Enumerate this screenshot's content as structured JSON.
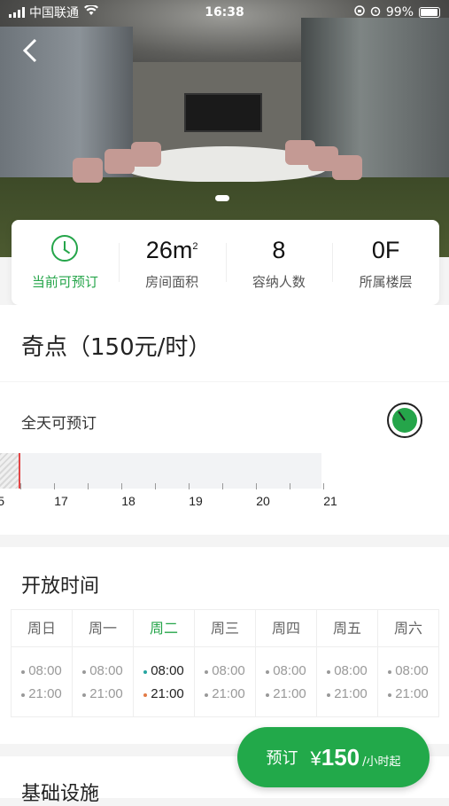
{
  "status_bar": {
    "carrier": "中国联通",
    "time": "16:38",
    "battery": "99%"
  },
  "stats": [
    {
      "value": "",
      "label": "当前可预订"
    },
    {
      "value": "26m",
      "sup": "2",
      "label": "房间面积"
    },
    {
      "value": "8",
      "label": "容纳人数"
    },
    {
      "value": "0F",
      "label": "所属楼层"
    }
  ],
  "room": {
    "title": "奇点（150元/时）"
  },
  "availability": {
    "label": "全天可预订",
    "ticks": [
      "5",
      "17",
      "18",
      "19",
      "20",
      "21"
    ]
  },
  "open_hours": {
    "title": "开放时间",
    "days": [
      {
        "name": "周日",
        "start": "08:00",
        "end": "21:00"
      },
      {
        "name": "周一",
        "start": "08:00",
        "end": "21:00"
      },
      {
        "name": "周二",
        "start": "08:00",
        "end": "21:00"
      },
      {
        "name": "周三",
        "start": "08:00",
        "end": "21:00"
      },
      {
        "name": "周四",
        "start": "08:00",
        "end": "21:00"
      },
      {
        "name": "周五",
        "start": "08:00",
        "end": "21:00"
      },
      {
        "name": "周六",
        "start": "08:00",
        "end": "21:00"
      }
    ]
  },
  "basic": {
    "title": "基础设施"
  },
  "book_button": {
    "label": "预订",
    "currency": "¥",
    "price": "150",
    "unit": "/小时起"
  },
  "colors": {
    "accent": "#22a94a",
    "now_marker": "#e24545"
  }
}
